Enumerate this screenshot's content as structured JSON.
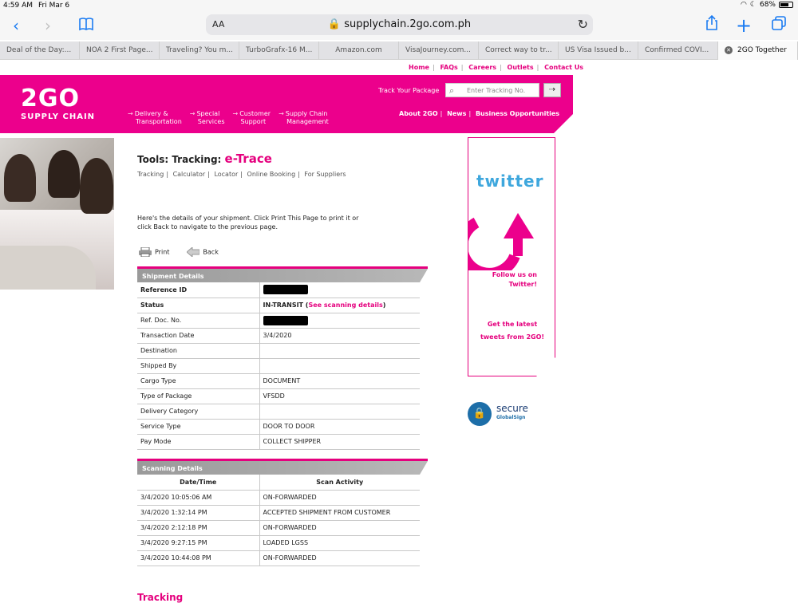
{
  "status_bar": {
    "time": "4:59 AM",
    "date": "Fri Mar 6",
    "battery": "68%"
  },
  "browser": {
    "url": "supplychain.2go.com.ph",
    "text_size_label": "AA",
    "tabs": [
      "Deal of the Day:...",
      "NOA 2 First Page...",
      "Traveling? You m...",
      "TurboGrafx-16 M...",
      "Amazon.com",
      "VisaJourney.com...",
      "Correct way to tr...",
      "US Visa Issued b...",
      "Confirmed COVI...",
      "2GO Together"
    ]
  },
  "topnav": [
    "Home",
    "FAQs",
    "Careers",
    "Outlets",
    "Contact Us"
  ],
  "header": {
    "logo_big": "2GO",
    "logo_small": "SUPPLY CHAIN",
    "main_nav": [
      {
        "line1": "Delivery &",
        "line2": "Transportation"
      },
      {
        "line1": "Special",
        "line2": "Services"
      },
      {
        "line1": "Customer",
        "line2": "Support"
      },
      {
        "line1": "Supply Chain",
        "line2": "Management"
      }
    ],
    "track_label": "Track Your Package",
    "track_placeholder": "Enter Tracking No.",
    "sub_nav": [
      "About 2GO",
      "News",
      "Business Opportunities"
    ]
  },
  "page": {
    "title_prefix": "Tools: Tracking:",
    "title_brand": "e-Trace",
    "sublinks": [
      "Tracking",
      "Calculator",
      "Locator",
      "Online Booking",
      "For Suppliers"
    ],
    "intro": "Here's the details of your shipment. Click Print This Page to print it or click Back to navigate to the previous page.",
    "print_label": "Print",
    "back_label": "Back",
    "bottom_peek": "Tracking"
  },
  "shipment": {
    "heading": "Shipment Details",
    "rows": [
      {
        "label": "Reference ID",
        "value": "",
        "redacted": true,
        "bold": true
      },
      {
        "label": "Status",
        "value": "IN-TRANSIT",
        "link": "See scanning details",
        "bold": true
      },
      {
        "label": "Ref. Doc. No.",
        "value": "",
        "redacted": true
      },
      {
        "label": "Transaction Date",
        "value": "3/4/2020"
      },
      {
        "label": "Destination",
        "value": ""
      },
      {
        "label": "Shipped By",
        "value": ""
      },
      {
        "label": "Cargo Type",
        "value": "DOCUMENT"
      },
      {
        "label": "Type of Package",
        "value": "VFSDD"
      },
      {
        "label": "Delivery Category",
        "value": ""
      },
      {
        "label": "Service Type",
        "value": "DOOR TO DOOR"
      },
      {
        "label": "Pay Mode",
        "value": "COLLECT SHIPPER"
      }
    ]
  },
  "scanning": {
    "heading": "Scanning Details",
    "columns": [
      "Date/Time",
      "Scan Activity"
    ],
    "rows": [
      [
        "3/4/2020 10:05:06 AM",
        "ON-FORWARDED"
      ],
      [
        "3/4/2020 1:32:14 PM",
        "ACCEPTED SHIPMENT FROM CUSTOMER"
      ],
      [
        "3/4/2020 2:12:18 PM",
        "ON-FORWARDED"
      ],
      [
        "3/4/2020 9:27:15 PM",
        "LOADED LGSS"
      ],
      [
        "3/4/2020 10:44:08 PM",
        "ON-FORWARDED"
      ]
    ]
  },
  "sidebar": {
    "twitter_logo": "twitter",
    "follow_line1": "Follow us on",
    "follow_line2": "Twitter!",
    "latest_line1": "Get the latest",
    "latest_line2": "tweets from 2GO!",
    "secure_text": "secure",
    "secure_sub": "GlobalSign"
  },
  "colors": {
    "brand_pink": "#ec008c",
    "ios_blue": "#1a7bf2"
  }
}
